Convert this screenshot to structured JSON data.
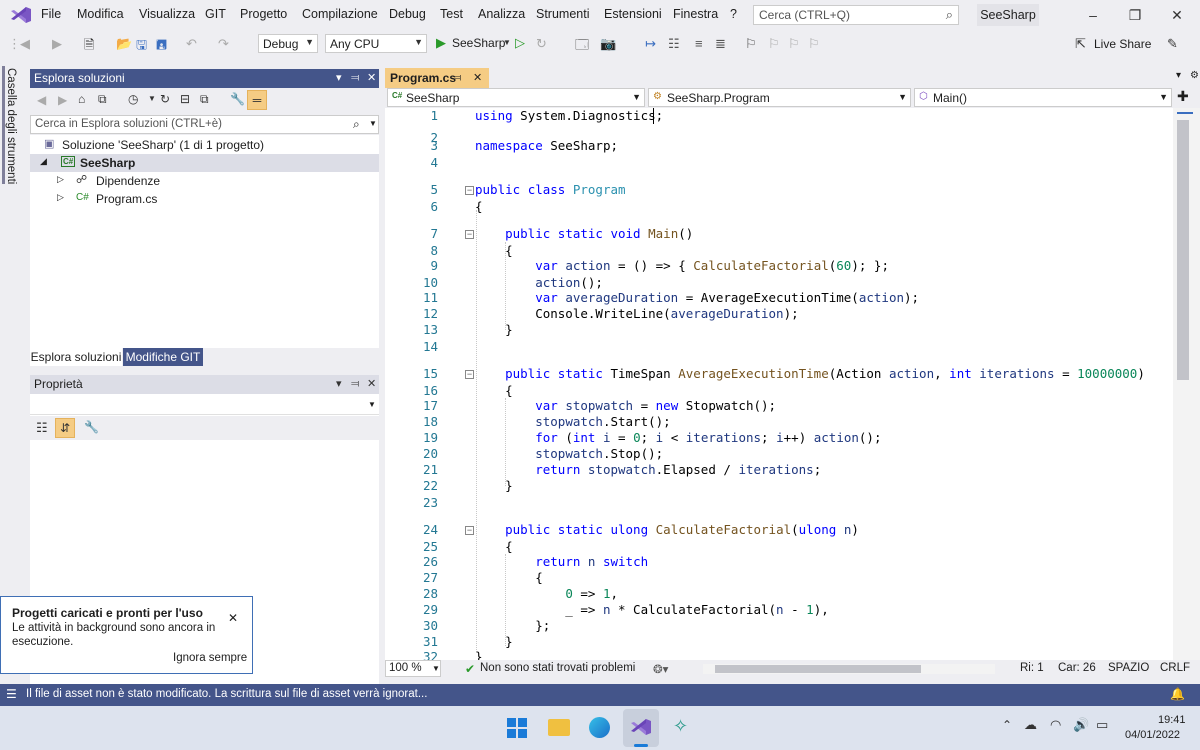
{
  "menu": [
    "File",
    "Modifica",
    "Visualizza",
    "GIT",
    "Progetto",
    "Compilazione",
    "Debug",
    "Test",
    "Analizza",
    "Strumenti",
    "Estensioni",
    "Finestra",
    "?"
  ],
  "search": {
    "placeholder": "Cerca (CTRL+Q)"
  },
  "solution_name": "SeeSharp",
  "toolbar": {
    "config": "Debug",
    "platform": "Any CPU",
    "run_label": "SeeSharp",
    "live_share": "Live Share"
  },
  "toolbox_label": "Casella degli strumenti",
  "solution_explorer": {
    "title": "Esplora soluzioni",
    "search_placeholder": "Cerca in Esplora soluzioni (CTRL+è)",
    "tree": [
      {
        "label": "Soluzione 'SeeSharp' (1 di 1 progetto)",
        "icon": "solution-icon"
      },
      {
        "label": "SeeSharp",
        "icon": "csharp-project-icon"
      },
      {
        "label": "Dipendenze",
        "icon": "dependencies-icon"
      },
      {
        "label": "Program.cs",
        "icon": "csharp-file-icon"
      }
    ],
    "tabs": [
      "Esplora soluzioni",
      "Modifiche GIT"
    ]
  },
  "properties": {
    "title": "Proprietà"
  },
  "editor": {
    "tab_label": "Program.cs",
    "nav_project": "SeeSharp",
    "nav_class": "SeeSharp.Program",
    "nav_member": "Main()",
    "lines": [
      "using System.Diagnostics;",
      "",
      "namespace SeeSharp;",
      "",
      "public class Program",
      "{",
      "    public static void Main()",
      "    {",
      "        var action = () => { CalculateFactorial(60); };",
      "        action();",
      "        var averageDuration = AverageExecutionTime(action);",
      "        Console.WriteLine(averageDuration);",
      "    }",
      "",
      "    public static TimeSpan AverageExecutionTime(Action action, int iterations = 10000000)",
      "    {",
      "        var stopwatch = new Stopwatch();",
      "        stopwatch.Start();",
      "        for (int i = 0; i < iterations; i++) action();",
      "        stopwatch.Stop();",
      "        return stopwatch.Elapsed / iterations;",
      "    }",
      "",
      "    public static ulong CalculateFactorial(ulong n)",
      "    {",
      "        return n switch",
      "        {",
      "            0 => 1,",
      "            _ => n * CalculateFactorial(n - 1),",
      "        };",
      "    }",
      "}"
    ],
    "zoom": "100 %",
    "issues": "Non sono stati trovati problemi",
    "row": "Ri: 1",
    "col": "Car: 26",
    "spacing": "SPAZIO",
    "eol": "CRLF"
  },
  "toast": {
    "title": "Progetti caricati e pronti per l'uso",
    "body": "Le attività in background sono ancora in esecuzione.",
    "action": "Ignora sempre"
  },
  "status": {
    "message": "Il file di asset non è stato modificato. La scrittura sul file di asset verrà ignorat..."
  },
  "taskbar": {
    "time": "19:41",
    "date": "04/01/2022"
  },
  "colors": {
    "accent": "#44558a",
    "tab_active": "#f5cc84",
    "vs_purple": "#7a56c4"
  }
}
